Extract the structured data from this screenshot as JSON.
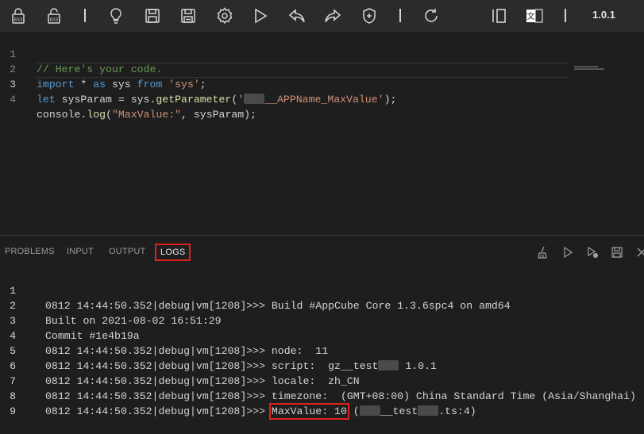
{
  "toolbar": {
    "version": "1.0.1",
    "icons": [
      "lock-icon",
      "unlock-icon",
      "lightbulb-icon",
      "save-icon",
      "save-all-icon",
      "settings-icon",
      "run-icon",
      "undo-icon",
      "redo-icon",
      "shield-add-icon",
      "refresh-icon",
      "split-view-icon",
      "translate-icon"
    ]
  },
  "editor": {
    "lines": [
      {
        "num": "1",
        "comment": "// Here's your code."
      },
      {
        "num": "2",
        "kw1": "import",
        "t1": " * ",
        "kw2": "as",
        "t2": " sys ",
        "kw3": "from",
        "t3": " ",
        "str": "'sys'",
        "t4": ";"
      },
      {
        "num": "3",
        "kw1": "let",
        "t1": " sysParam = sys.",
        "fn": "getParameter",
        "t2": "(",
        "str1": "'",
        "str2": "__APPName_MaxValue'",
        "t3": ");"
      },
      {
        "num": "4",
        "t1": "console.",
        "fn": "log",
        "t2": "(",
        "str": "\"MaxValue:\"",
        "t3": ", sysParam);"
      }
    ]
  },
  "panel": {
    "tabs": [
      "PROBLEMS",
      "INPUT",
      "OUTPUT",
      "LOGS"
    ],
    "active_tab": "LOGS",
    "icons": [
      "clear-icon",
      "run-icon",
      "run-debug-icon",
      "save-icon",
      "close-icon"
    ]
  },
  "logs": {
    "lines": [
      {
        "num": "1",
        "text": "0812 14:44:50.352|debug|vm[1208]>>> Build #AppCube Core 1.3.6spc4 on amd64"
      },
      {
        "num": "2",
        "text": "Built on 2021-08-02 16:51:29"
      },
      {
        "num": "3",
        "text": "Commit #1e4b19a"
      },
      {
        "num": "4",
        "text": "0812 14:44:50.352|debug|vm[1208]>>> node:  11"
      },
      {
        "num": "5",
        "text_a": "0812 14:44:50.352|debug|vm[1208]>>> script:  gz__test",
        "text_b": " 1.0.1"
      },
      {
        "num": "6",
        "text": "0812 14:44:50.352|debug|vm[1208]>>> locale:  zh_CN"
      },
      {
        "num": "7",
        "text": "0812 14:44:50.352|debug|vm[1208]>>> timezone:  (GMT+08:00) China Standard Time (Asia/Shanghai)"
      },
      {
        "num": "8",
        "text_a": "0812 14:44:50.352|debug|vm[1208]>>> ",
        "highlight": "MaxValue: 10",
        "text_b": " (",
        "text_c": "__test",
        "text_d": ".ts:4)"
      },
      {
        "num": "9"
      }
    ]
  }
}
